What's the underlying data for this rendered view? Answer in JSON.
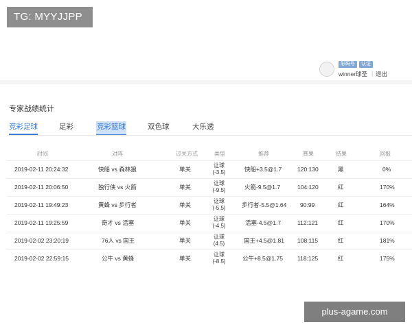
{
  "tg_label": "TG: MYYJJPP",
  "user": {
    "badge_1": "彩码号",
    "badge_2": "认证",
    "name": "winner球圣",
    "separator": "|",
    "logout": "退出"
  },
  "panel": {
    "title": "专家战绩统计",
    "tabs": [
      {
        "label": "竞彩足球"
      },
      {
        "label": "足彩"
      },
      {
        "label": "竞彩篮球"
      },
      {
        "label": "双色球"
      },
      {
        "label": "大乐透"
      }
    ]
  },
  "table": {
    "headers": [
      "时间",
      "对阵",
      "过关方式",
      "类型",
      "推荐",
      "赛果",
      "结果",
      "回报"
    ],
    "rows": [
      {
        "time": "2019-02-11 20:24:32",
        "match": "快船 vs 森林狼",
        "pass": "单关",
        "type_1": "让球",
        "type_2": "(-3.5)",
        "pick": "快船+3.5@1.7",
        "score": "120:130",
        "result": "黑",
        "return": "0%"
      },
      {
        "time": "2019-02-11 20:06:50",
        "match": "独行侠 vs 火箭",
        "pass": "单关",
        "type_1": "让球",
        "type_2": "(-9.5)",
        "pick": "火箭-9.5@1.7",
        "score": "104:120",
        "result": "红",
        "return": "170%"
      },
      {
        "time": "2019-02-11 19:49:23",
        "match": "黄蜂 vs 步行者",
        "pass": "单关",
        "type_1": "让球",
        "type_2": "(-5.5)",
        "pick": "步行者-5.5@1.64",
        "score": "90:99",
        "result": "红",
        "return": "164%"
      },
      {
        "time": "2019-02-11 19:25:59",
        "match": "奇才 vs 活塞",
        "pass": "单关",
        "type_1": "让球",
        "type_2": "(-4.5)",
        "pick": "活塞-4.5@1.7",
        "score": "112:121",
        "result": "红",
        "return": "170%"
      },
      {
        "time": "2019-02-02 23:20:19",
        "match": "76人 vs 国王",
        "pass": "单关",
        "type_1": "让球",
        "type_2": "(4.5)",
        "pick": "国王+4.5@1.81",
        "score": "108:115",
        "result": "红",
        "return": "181%"
      },
      {
        "time": "2019-02-02 22:59:15",
        "match": "公牛 vs 黄蜂",
        "pass": "单关",
        "type_1": "让球",
        "type_2": "(-8.5)",
        "pick": "公牛+8.5@1.75",
        "score": "118:125",
        "result": "红",
        "return": "175%"
      }
    ]
  },
  "watermark": "plus-agame.com",
  "colors": {
    "accent": "#3a7bd5",
    "tab_highlight": "#cfe1f6",
    "badge_bg": "#7fa8d8"
  }
}
